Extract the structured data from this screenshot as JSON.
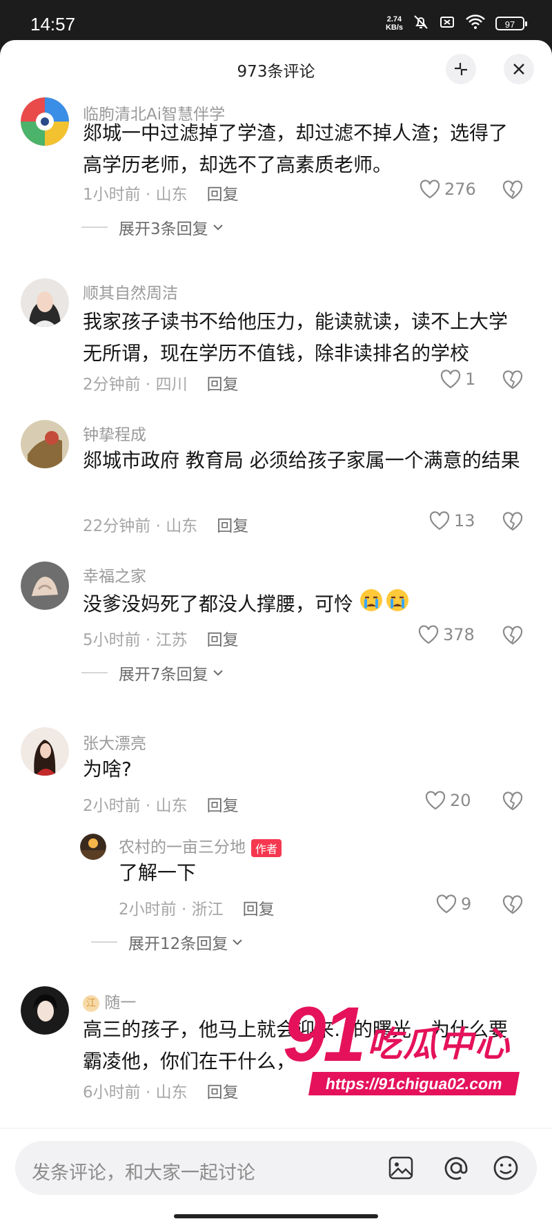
{
  "status_bar": {
    "time": "14:57",
    "speed_top": "2.74",
    "speed_unit": "KB/s",
    "battery": "97",
    "icons": [
      "mute-bell-icon",
      "sim-off-icon",
      "wifi-icon",
      "battery-icon"
    ]
  },
  "sheet": {
    "title": "973条评论",
    "collapse_icon": "collapse-icon",
    "close_icon": "close-icon"
  },
  "comments": [
    {
      "name": "临朐清北Ai智慧伴学",
      "text": "郯城一中过滤掉了学渣，却过滤不掉人渣；选得了高学历老师，却选不了高素质老师。",
      "meta": "1小时前 · 山东",
      "reply": "回复",
      "likes": "276",
      "expand": "展开3条回复"
    },
    {
      "name": "顺其自然周洁",
      "text": "我家孩子读书不给他压力，能读就读，读不上大学无所谓，现在学历不值钱，除非读排名的学校",
      "meta": "2分钟前 · 四川",
      "reply": "回复",
      "likes": "1"
    },
    {
      "name": "钟挚程成",
      "text": "郯城市政府 教育局 必须给孩子家属一个满意的结果",
      "meta": "22分钟前 · 山东",
      "reply": "回复",
      "likes": "13"
    },
    {
      "name": "幸福之家",
      "text": "没爹没妈死了都没人撑腰，可怜",
      "meta": "5小时前 · 江苏",
      "reply": "回复",
      "likes": "378",
      "expand": "展开7条回复"
    },
    {
      "name": "张大漂亮",
      "text": "为啥?",
      "meta": "2小时前 · 山东",
      "reply": "回复",
      "likes": "20",
      "sub_reply": {
        "name": "农村的一亩三分地",
        "tag": "作者",
        "text": "了解一下",
        "meta": "2小时前 · 浙江",
        "reply": "回复",
        "likes": "9"
      },
      "expand": "展开12条回复"
    },
    {
      "name": "随一",
      "text": "高三的孩子，他马上就会迎来…的曙光，为什么要霸凌他，你们在干什么，",
      "meta": "6小时前 · 山东",
      "reply": "回复"
    }
  ],
  "watermark": {
    "num": "91",
    "cn": "吃瓜中心",
    "url": "https://91chigua02.com"
  },
  "input": {
    "placeholder": "发条评论，和大家一起讨论",
    "icons": [
      "image-icon",
      "at-icon",
      "emoji-icon"
    ]
  }
}
